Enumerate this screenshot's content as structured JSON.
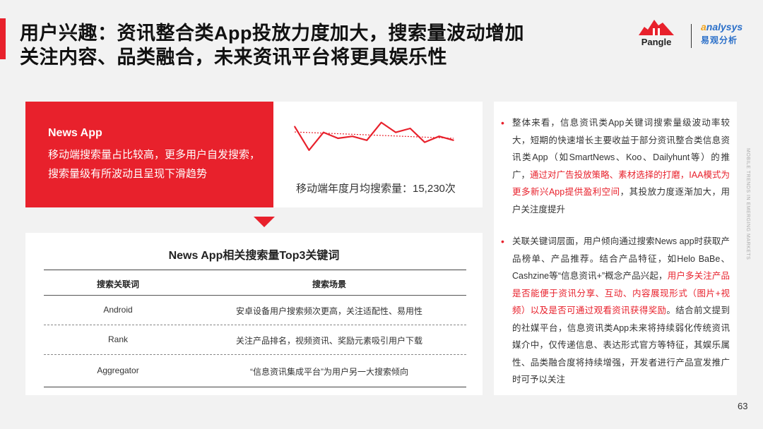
{
  "title": {
    "line1": "用户兴趣：资讯整合类App投放力度加大，搜索量波动增加",
    "line2": "关注内容、品类融合，未来资讯平台将更具娱乐性"
  },
  "logos": {
    "pangle": "Pangle",
    "analysys_prefix": "a",
    "analysys_rest": "nalysys",
    "analysys_cn": "易观分析"
  },
  "highlight_box": {
    "heading": "News App",
    "text": "移动端搜索量占比较高，更多用户自发搜索，搜索量级有所波动且呈现下滑趋势"
  },
  "chart_data": {
    "type": "line",
    "title": "",
    "series": [
      {
        "values": [
          8,
          2,
          6.5,
          5,
          5.5,
          4.5,
          9,
          6.5,
          7.5,
          4,
          5.5,
          4.5
        ]
      }
    ],
    "trend": [
      6.6,
      5.0
    ],
    "caption": "移动端年度月均搜索量：15,230次"
  },
  "keyword_table": {
    "title": "News App相关搜索量Top3关键词",
    "headers": [
      "搜索关联词",
      "搜索场景"
    ],
    "rows": [
      {
        "keyword": "Android",
        "scene": "安卓设备用户搜索频次更高，关注适配性、易用性"
      },
      {
        "keyword": "Rank",
        "scene": "关注产品排名，视频资讯、奖励元素吸引用户下载"
      },
      {
        "keyword": "Aggregator",
        "scene": "“信息资讯集成平台”为用户另一大搜索倾向"
      }
    ]
  },
  "bullets": [
    {
      "text_a": "整体来看，信息资讯类App关键词搜索量级波动率较大，短期的快速增长主要收益于部分资讯整合类信息资讯类App（如SmartNews、Koo、Dailyhunt等）的推广，",
      "text_hl": "通过对广告投放策略、素材选择的打磨，IAA模式为更多新兴App提供盈利空间",
      "text_b": "，其投放力度逐渐加大，用户关注度提升"
    },
    {
      "text_a": "关联关键词层面，用户倾向通过搜索News app时获取产品榜单、产品推荐。结合产品特征，如Helo BaBe、Cashzine等“信息资讯+”概念产品兴起，",
      "text_hl": "用户多关注产品是否能便于资讯分享、互动、内容展现形式（图片+视频）以及是否可通过观看资讯获得奖励",
      "text_b": "。结合前文提到的社媒平台，信息资讯类App未来将持续弱化传统资讯媒介中，仅传递信息、表达形式官方等特征，其娱乐属性、品类融合度将持续增强，开发者进行产品宣发推广时可予以关注"
    }
  ],
  "side_text": "MOBILE TRENDS IN EMERGING MARKETS",
  "page_number": "63",
  "colors": {
    "accent": "#e8212c",
    "analysys_blue": "#2a6fc9",
    "analysys_orange": "#f0a21a"
  }
}
